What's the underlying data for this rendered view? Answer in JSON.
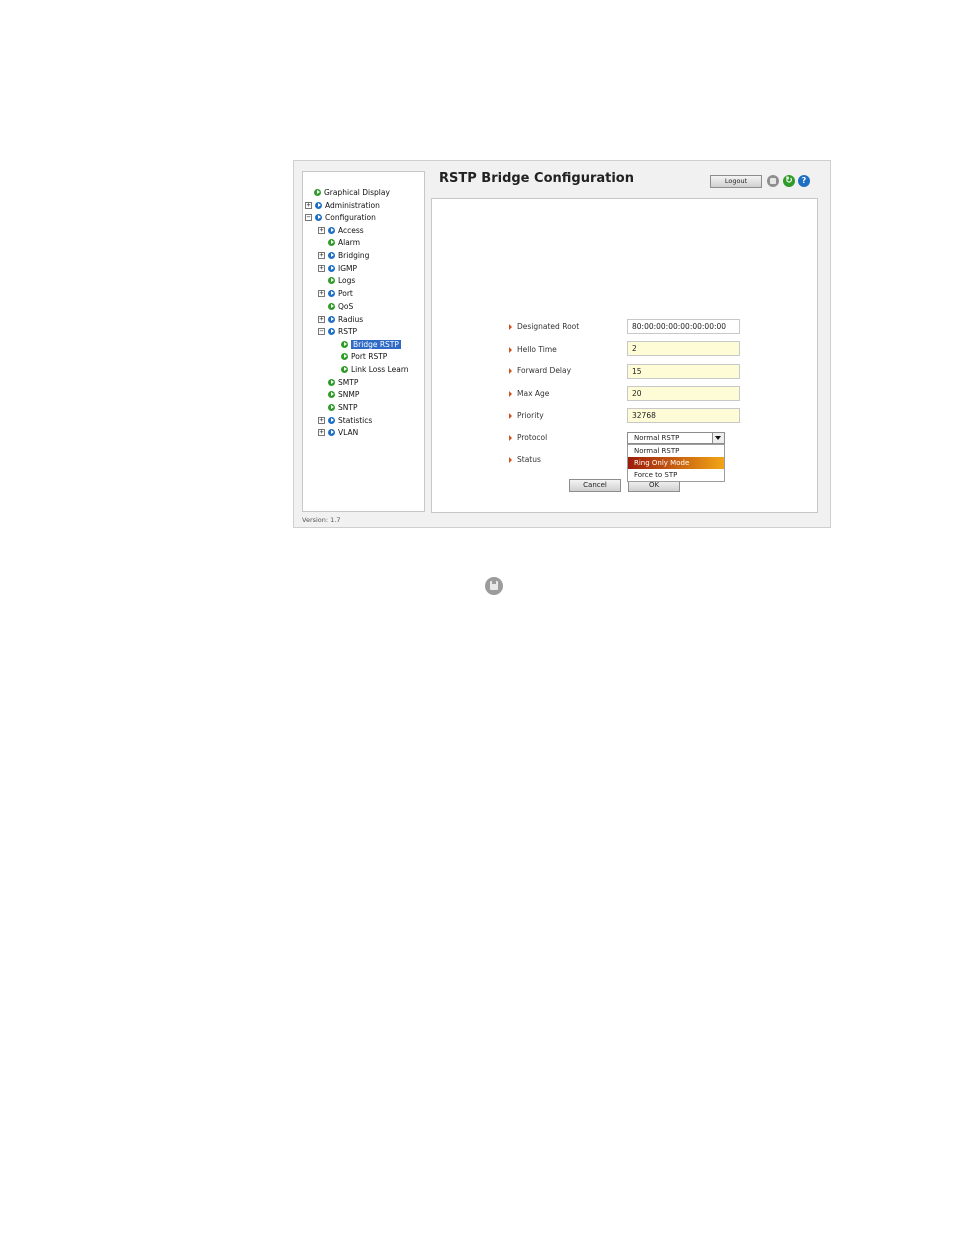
{
  "header": {
    "title": "RSTP Bridge Configuration",
    "logout_label": "Logout",
    "icons": {
      "save": "save-icon",
      "refresh": "refresh-icon",
      "help": "help-icon"
    },
    "help_glyph": "?",
    "refresh_glyph": "↻"
  },
  "sidebar": {
    "items": [
      {
        "label": "Graphical Display",
        "expander": "",
        "icon": "blue"
      },
      {
        "label": "Administration",
        "expander": "+",
        "icon": "blue"
      },
      {
        "label": "Configuration",
        "expander": "−",
        "icon": "blue"
      },
      {
        "label": "Access",
        "expander": "+",
        "icon": "blue"
      },
      {
        "label": "Alarm",
        "expander": "",
        "icon": "green"
      },
      {
        "label": "Bridging",
        "expander": "+",
        "icon": "blue"
      },
      {
        "label": "IGMP",
        "expander": "+",
        "icon": "blue"
      },
      {
        "label": "Logs",
        "expander": "",
        "icon": "green"
      },
      {
        "label": "Port",
        "expander": "+",
        "icon": "blue"
      },
      {
        "label": "QoS",
        "expander": "",
        "icon": "green"
      },
      {
        "label": "Radius",
        "expander": "+",
        "icon": "blue"
      },
      {
        "label": "RSTP",
        "expander": "−",
        "icon": "blue"
      },
      {
        "label": "Bridge RSTP",
        "expander": "",
        "icon": "green",
        "selected": true
      },
      {
        "label": "Port RSTP",
        "expander": "",
        "icon": "green"
      },
      {
        "label": "Link Loss Learn",
        "expander": "",
        "icon": "green"
      },
      {
        "label": "SMTP",
        "expander": "",
        "icon": "green"
      },
      {
        "label": "SNMP",
        "expander": "",
        "icon": "green"
      },
      {
        "label": "SNTP",
        "expander": "",
        "icon": "green"
      },
      {
        "label": "Statistics",
        "expander": "+",
        "icon": "blue"
      },
      {
        "label": "VLAN",
        "expander": "+",
        "icon": "blue"
      }
    ],
    "version": "Version: 1.7"
  },
  "form": {
    "designated_root": {
      "label": "Designated Root",
      "value": "80:00:00:00:00:00:00:00"
    },
    "hello_time": {
      "label": "Hello Time",
      "value": "2"
    },
    "forward_delay": {
      "label": "Forward Delay",
      "value": "15"
    },
    "max_age": {
      "label": "Max Age",
      "value": "20"
    },
    "priority": {
      "label": "Priority",
      "value": "32768"
    },
    "protocol": {
      "label": "Protocol",
      "selected": "Normal RSTP",
      "options": [
        "Normal RSTP",
        "Ring Only Mode",
        "Force to STP"
      ],
      "highlighted_option": "Ring Only Mode"
    },
    "status": {
      "label": "Status"
    },
    "cancel_label": "Cancel",
    "ok_label": "OK"
  },
  "colors": {
    "accent_blue": "#2f6ac6",
    "field_bg": "#fefcd6",
    "arrow": "#d2501b",
    "highlight_start": "#9c1b0b",
    "highlight_end": "#f2a516"
  }
}
